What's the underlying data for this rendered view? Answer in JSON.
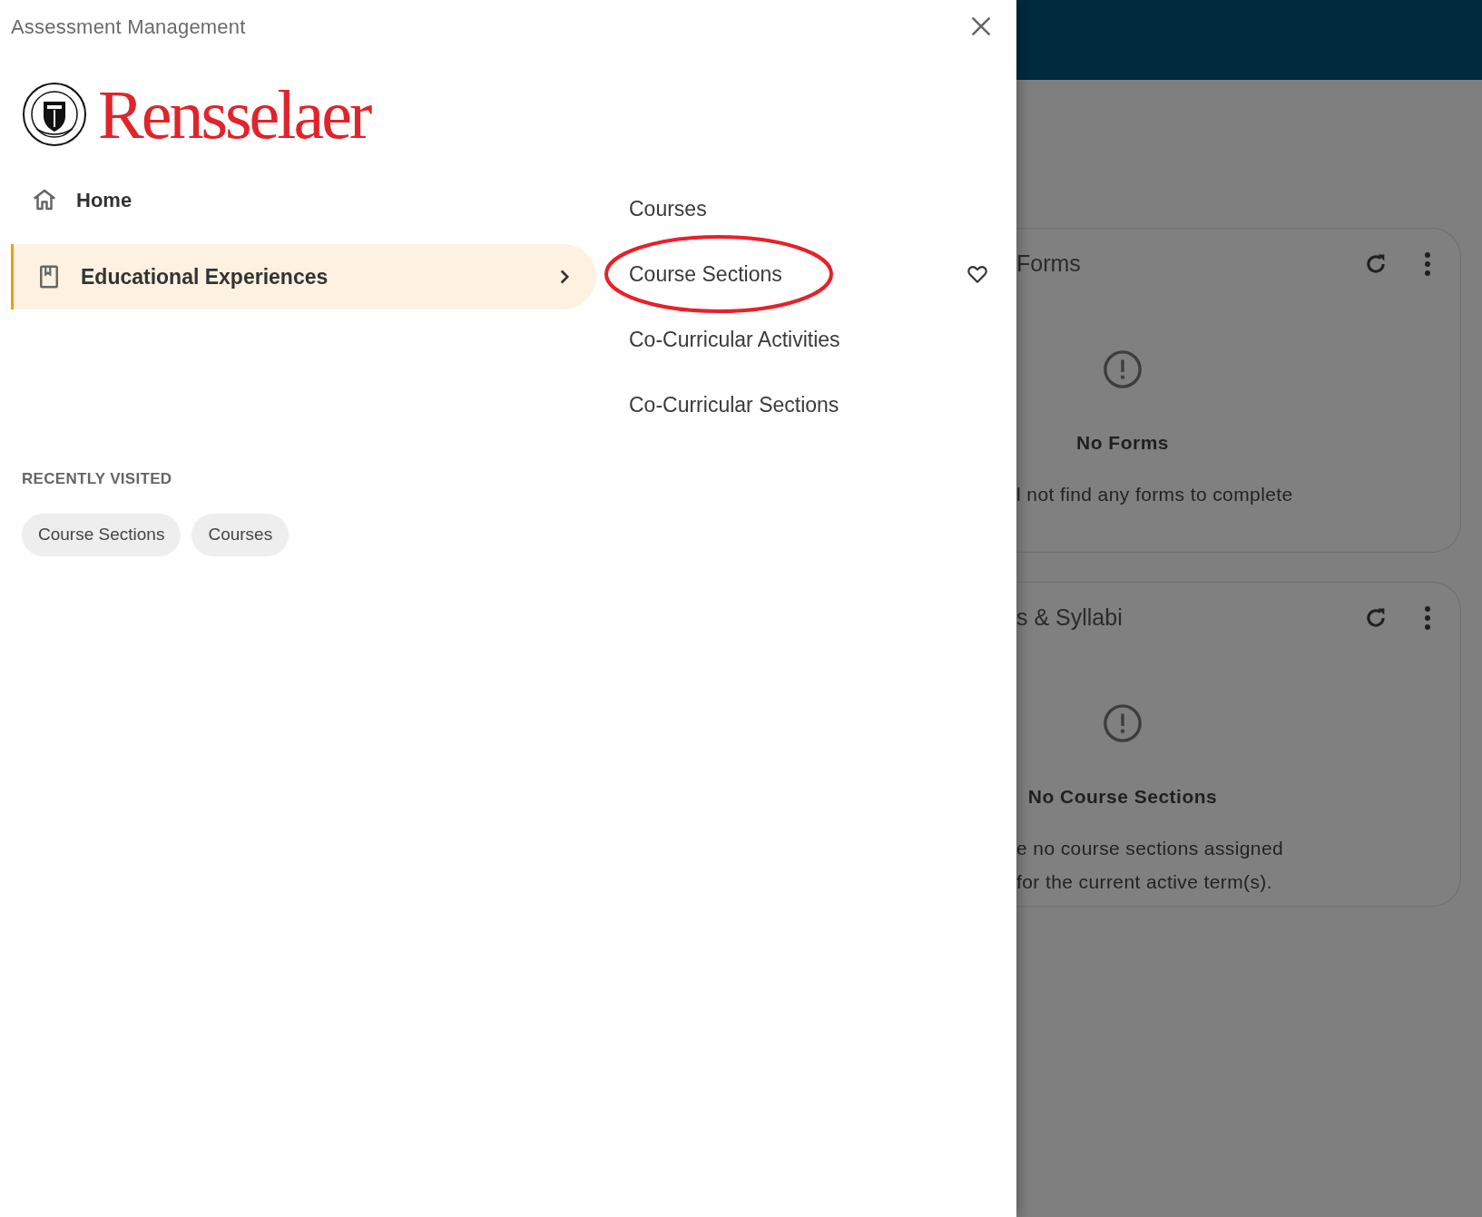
{
  "drawer": {
    "title": "Assessment Management",
    "logo": {
      "wordmark": "Rensselaer"
    },
    "nav": [
      {
        "label": "Home",
        "selected": false,
        "expandable": false
      },
      {
        "label": "Educational Experiences",
        "selected": true,
        "expandable": true
      }
    ],
    "submenu": [
      {
        "label": "Courses",
        "circled": false,
        "favorite_shown": false
      },
      {
        "label": "Course Sections",
        "circled": true,
        "favorite_shown": true
      },
      {
        "label": "Co-Curricular Activities",
        "circled": false,
        "favorite_shown": false
      },
      {
        "label": "Co-Curricular Sections",
        "circled": false,
        "favorite_shown": false
      }
    ],
    "recently_visited": {
      "heading": "RECENTLY VISITED",
      "chips": [
        "Course Sections",
        "Courses"
      ]
    }
  },
  "background": {
    "cards": [
      {
        "title": "Forms",
        "empty_title": "No Forms",
        "empty_lines": [
          "l not find any forms to complete"
        ]
      },
      {
        "title": "s & Syllabi",
        "empty_title": "No Course Sections",
        "empty_lines": [
          "e no course sections assigned",
          "for the current active term(s)."
        ]
      }
    ]
  }
}
